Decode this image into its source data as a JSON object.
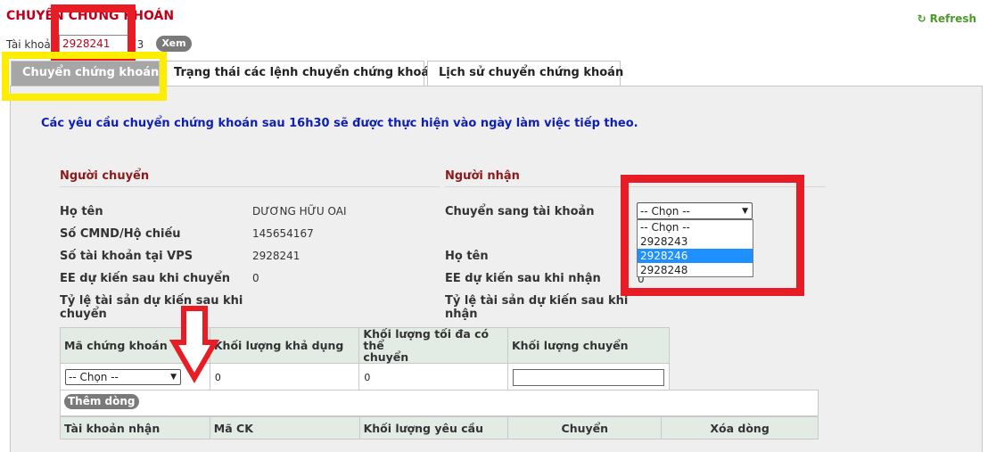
{
  "header": {
    "title": "CHUYỂN CHỨNG KHOÁN",
    "refresh_label": "Refresh",
    "account_label": "Tài khoản",
    "account_value": "2928241",
    "account_suffix": "[3",
    "view_button": "Xem"
  },
  "tabs": [
    {
      "label": "Chuyển chứng khoán",
      "active": true
    },
    {
      "label": "Trạng thái các lệnh chuyển chứng khoán",
      "active": false
    },
    {
      "label": "Lịch sử chuyển chứng khoán",
      "active": false
    }
  ],
  "notice": "Các yêu cầu chuyển chứng khoán sau 16h30 sẽ được thực hiện vào ngày làm việc tiếp theo.",
  "sender": {
    "heading": "Người chuyển",
    "rows": [
      {
        "label": "Họ tên",
        "value": "DƯƠNG HỮU OAI"
      },
      {
        "label": "Số CMND/Hộ chiếu",
        "value": "145654167"
      },
      {
        "label": "Số tài khoản tại VPS",
        "value": "2928241"
      },
      {
        "label": "EE dự kiến sau khi chuyển",
        "value": "0"
      },
      {
        "label_line1": "Tỷ lệ tài sản dự kiến sau khi",
        "label_line2": "chuyển",
        "value": ""
      }
    ]
  },
  "receiver": {
    "heading": "Người nhận",
    "transfer_to_label": "Chuyển sang tài khoản",
    "select_value": "-- Chọn --",
    "options": [
      "-- Chọn --",
      "2928243",
      "2928246",
      "2928248"
    ],
    "highlighted_option": "2928246",
    "name_label": "Họ tên",
    "ee_label": "EE dự kiến sau khi nhận",
    "ee_value": "0",
    "ratio_line1": "Tỷ lệ tài sản dự kiến sau khi",
    "ratio_line2": "nhận"
  },
  "stock_table": {
    "headers": [
      "Mã chứng khoán",
      "Khối lượng khả dụng",
      "Khối lượng tối đa có thể chuyển",
      "Khối lượng chuyển"
    ],
    "header3_line1": "Khối lượng tối đa có thể",
    "header3_line2": "chuyển",
    "select_value": "-- Chọn --",
    "available": "0",
    "max": "0",
    "transfer_qty": ""
  },
  "add_row_button": "Thêm dòng",
  "requests_table": {
    "headers": [
      "Tài khoản nhận",
      "Mã CK",
      "Khối lượng yêu cầu",
      "Chuyển",
      "Xóa dòng"
    ]
  },
  "colors": {
    "title_red": "#c0001a",
    "notice_blue": "#0f1fb3",
    "refresh_green": "#4c9a2a",
    "annotation_red": "#e81c24",
    "annotation_yellow": "#ffed00"
  }
}
